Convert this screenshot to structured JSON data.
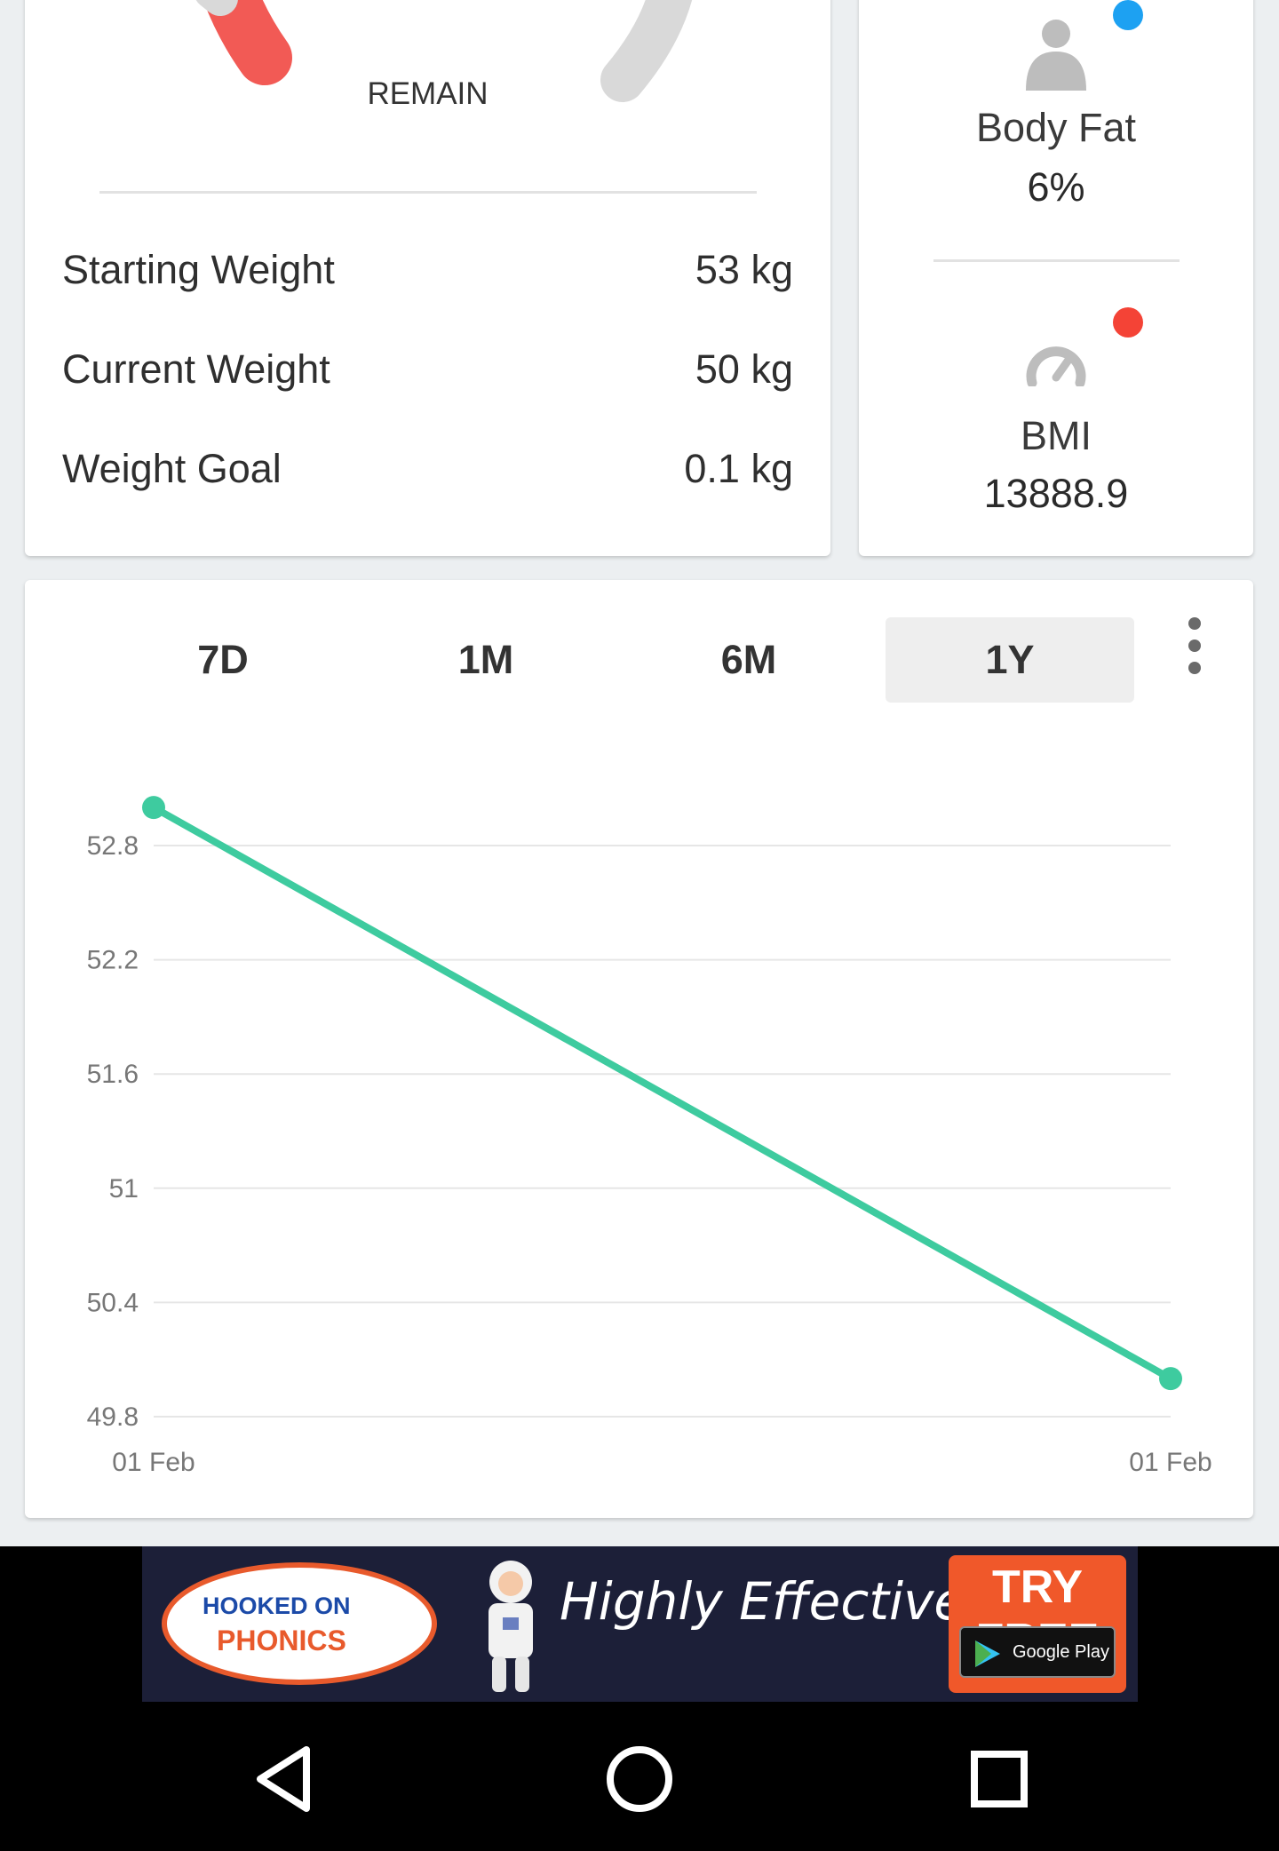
{
  "weight_card": {
    "remain_label": "REMAIN",
    "rows": [
      {
        "label": "Starting Weight",
        "value": "53 kg"
      },
      {
        "label": "Current Weight",
        "value": "50 kg"
      },
      {
        "label": "Weight Goal",
        "value": "0.1 kg"
      }
    ]
  },
  "metrics_card": {
    "body_fat": {
      "label": "Body Fat",
      "value": "6%",
      "icon": "person-icon",
      "dot_color": "#1da1f2"
    },
    "bmi": {
      "label": "BMI",
      "value": "13888.9",
      "icon": "speedometer-icon",
      "dot_color": "#f44336"
    }
  },
  "tabs": [
    {
      "label": "7D",
      "active": false
    },
    {
      "label": "1M",
      "active": false
    },
    {
      "label": "6M",
      "active": false
    },
    {
      "label": "1Y",
      "active": true
    }
  ],
  "chart_data": {
    "type": "line",
    "x": [
      "01 Feb",
      "01 Feb"
    ],
    "series": [
      {
        "values": [
          53.0,
          50.0
        ],
        "color": "#3ecb9f"
      }
    ],
    "yticks": [
      "52.8",
      "52.2",
      "51.6",
      "51",
      "50.4",
      "49.8"
    ],
    "ytick_values": [
      52.8,
      52.2,
      51.6,
      51.0,
      50.4,
      49.8
    ],
    "grid": true
  },
  "ad": {
    "logo_line1": "HOOKED ON",
    "logo_line2": "PHONICS",
    "headline": "Highly Effective,",
    "cta": "TRY FREE",
    "store": "Google Play"
  },
  "colors": {
    "accent": "#3ecb9f",
    "gauge_red": "#f25a55",
    "gauge_grey": "#d9d9d9"
  }
}
